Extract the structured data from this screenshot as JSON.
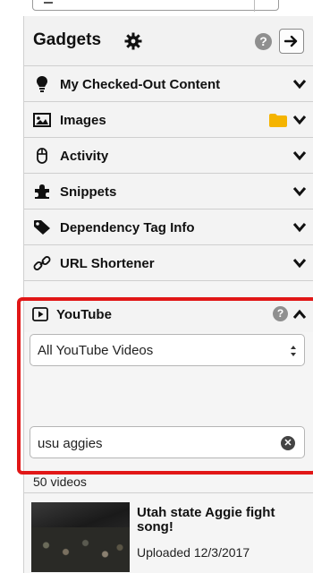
{
  "header": {
    "title": "Gadgets",
    "help_symbol": "?",
    "icons": [
      "gear-icon",
      "help-icon",
      "arrow-right-icon"
    ]
  },
  "sections": [
    {
      "label": "My Checked-Out Content",
      "icon": "lightbulb-icon"
    },
    {
      "label": "Images",
      "icon": "image-icon"
    },
    {
      "label": "Activity",
      "icon": "mouse-icon"
    },
    {
      "label": "Snippets",
      "icon": "puzzle-icon"
    },
    {
      "label": "Dependency Tag Info",
      "icon": "tag-icon"
    },
    {
      "label": "URL Shortener",
      "icon": "link-icon"
    }
  ],
  "youtube": {
    "label": "YouTube",
    "help_symbol": "?",
    "filter_selected": "All YouTube Videos",
    "search_value": "usu aggies",
    "video_count": "50 videos",
    "videos": [
      {
        "title": "Utah state Aggie fight song!",
        "uploaded": "Uploaded 12/3/2017"
      }
    ]
  },
  "colors": {
    "highlight_outline": "#e11717",
    "folder": "#f5b400",
    "panel_bg": "#f5f5f5"
  }
}
